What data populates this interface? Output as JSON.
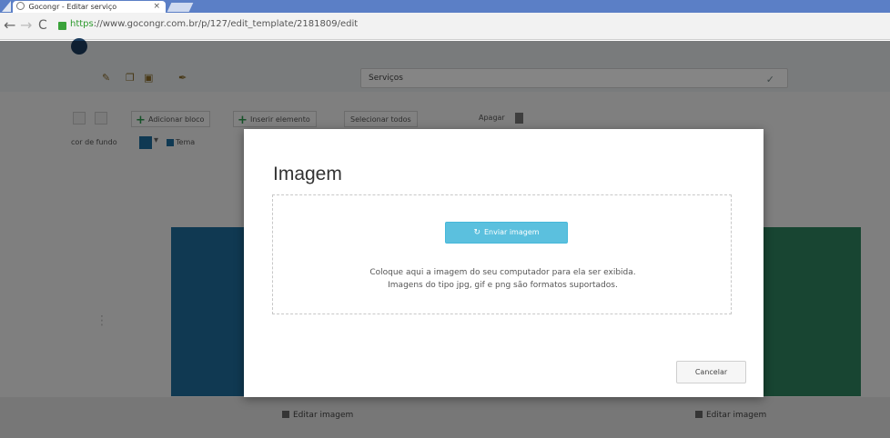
{
  "browser": {
    "tab_title": "Gocongr - Editar serviço",
    "tab_close": "×",
    "url_secure": "https",
    "url_rest": "://www.gocongr.com.br/p/127/edit_template/2181809/edit",
    "nav": {
      "back": "←",
      "forward": "→",
      "reload": "C"
    }
  },
  "toolbar": {
    "icons": [
      "paint-icon",
      "layers-icon",
      "image-icon",
      "pin-icon"
    ],
    "page_name": "Serviços",
    "page_name_icon": "✓"
  },
  "editor": {
    "add_block_label": "Adicionar bloco",
    "add_element_label": "Inserir elemento",
    "select_all_label": "Selecionar todos",
    "delete_label": "Apagar",
    "background_color_label": "cor de fundo",
    "theme_label": "Tema",
    "swatch_color": "#1e6da0"
  },
  "bottom": {
    "left_link": "Editar imagem",
    "right_link": "Editar imagem"
  },
  "modal": {
    "title": "Imagem",
    "upload_button": "Enviar imagem",
    "upload_icon": "↻",
    "help_line1": "Coloque aqui a imagem do seu computador para ela ser exibida.",
    "help_line2": "Imagens do tipo jpg, gif e png são formatos suportados.",
    "cancel_button": "Cancelar"
  },
  "colors": {
    "accent": "#5bc0de",
    "blue_block": "#1f6e9e",
    "green_block": "#2e8560"
  }
}
